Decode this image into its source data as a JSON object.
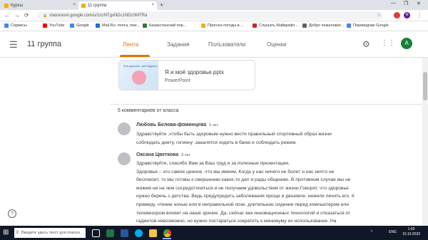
{
  "browser": {
    "tabs": [
      {
        "label": "Курсы"
      },
      {
        "label": "11 группа"
      }
    ],
    "new_tab": "+",
    "win_minimize": "—",
    "win_restore": "❐",
    "win_close": "✕",
    "tab_close": "×",
    "back": "←",
    "forward": "→",
    "reload": "⟳",
    "url": "classroom.google.com/u/1/c/NTgxNDc1NDc0MTRa",
    "avatar_small": "N",
    "menu": "⋮"
  },
  "bookmarks": [
    {
      "label": "Сервисы",
      "color": "#4285f4"
    },
    {
      "label": "YouTube",
      "color": "#ff0000"
    },
    {
      "label": "Google",
      "color": "#4285f4"
    },
    {
      "label": "Mail.Ru: почта, пои...",
      "color": "#1f6fd1"
    },
    {
      "label": "Казахстанский пор...",
      "color": "#2e7d32"
    },
    {
      "label": "Прогноз погоды в ...",
      "color": "#f9a825"
    },
    {
      "label": "Слушать Майкрафт...",
      "color": "#c62828"
    },
    {
      "label": "Добро пожаловат...",
      "color": "#616161"
    },
    {
      "label": "Переводчик Google",
      "color": "#4285f4"
    }
  ],
  "header": {
    "menu_icon": "☰",
    "class_title": "11 группа",
    "tabs": [
      {
        "label": "Лента",
        "selected": true
      },
      {
        "label": "Задания",
        "selected": false
      },
      {
        "label": "Пользователи",
        "selected": false
      },
      {
        "label": "Оценки",
        "selected": false
      }
    ],
    "settings_icon": "⚙",
    "apps_icon": "⋮⋮⋮",
    "avatar_letter": "A",
    "accent_color": "#e37400"
  },
  "attachment": {
    "thumb_text": "Моя здоровье - моё будущее",
    "title": "Я и моё здоровье.pptx",
    "type": "PowerPoint"
  },
  "comments_header": "5 комментариев от класса",
  "comments": [
    {
      "author": "Любовь Белова-фоминцева",
      "date": "9 окт.",
      "lines": [
        "Здравствуйте ,чтобы быть здоровым нужно вести правильный спортивный образ жизни",
        "соблюдать диету, гигиену ,закалятся ходить в баню и соблюдать режим."
      ]
    },
    {
      "author": "Оксана Цветкова",
      "date": "9 окт.",
      "lines": [
        "Здравствуйте,  спасибо Вам за Ваш труд и за полезные презентации.",
        "Здоровье – это самое ценное, что мы имеем. Когда у нас ничего не болит и нас ничто не",
        "беспокоит, то мы готовы к свершению каких-то дел и рады общению. В противном случае мы не",
        "можем ни на чем сосредоточиться и не получаем удовольствия от жизни.Говорят, что здоровье",
        "нужно беречь с детства. Ведь предупредить заболевания проще и дешевле, нежели лечить его. К",
        "примеру, чтение ночью или в неправильной позе, длительное сидение перед компьютером или",
        "телевизором влияет на наше зрение. Да, сейчас век инновационных технологий и отказаться от",
        "гаджетов невозможно, но нужно постараться сократить к минимуму их использование. На"
      ]
    }
  ],
  "help_icon": "?",
  "taskbar": {
    "start_icon": "⊞",
    "search_icon": "⚲",
    "search_placeholder": "Введите здесь текст для поиска",
    "apps": [
      {
        "name": "task-view",
        "color": "#ffffff"
      },
      {
        "name": "excel",
        "color": "#217346"
      },
      {
        "name": "word",
        "color": "#2b579a"
      },
      {
        "name": "skype",
        "color": "#00aff0"
      },
      {
        "name": "explorer",
        "color": "#f4c542"
      },
      {
        "name": "chrome",
        "color": "#34a853"
      }
    ],
    "tray_arrow": "^",
    "tray_lang": "ENG",
    "time": "1:00",
    "date": "10.10.2020"
  }
}
